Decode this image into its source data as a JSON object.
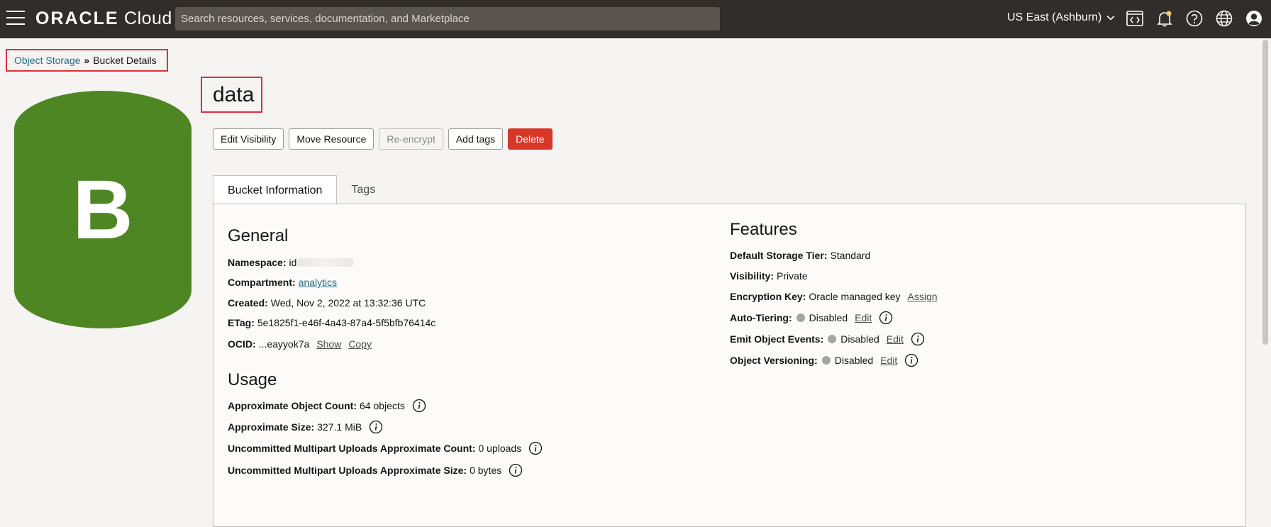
{
  "topbar": {
    "logo_brand": "ORACLE",
    "logo_product": "Cloud",
    "search_placeholder": "Search resources, services, documentation, and Marketplace",
    "region": "US East (Ashburn)",
    "icons": [
      "menu-icon",
      "code-editor-icon",
      "notification-bell-icon",
      "help-icon",
      "language-globe-icon",
      "user-profile-icon"
    ],
    "notification_color": "#f0cc71"
  },
  "breadcrumb": {
    "parent": "Object Storage",
    "separator": "»",
    "current": "Bucket Details"
  },
  "avatar": {
    "letter": "B",
    "color": "#4d8623"
  },
  "bucket": {
    "name": "data"
  },
  "actions": {
    "edit_visibility": "Edit Visibility",
    "move_resource": "Move Resource",
    "re_encrypt": "Re-encrypt",
    "add_tags": "Add tags",
    "delete": "Delete"
  },
  "tabs": [
    {
      "label": "Bucket Information",
      "active": true
    },
    {
      "label": "Tags",
      "active": false
    }
  ],
  "general": {
    "title": "General",
    "namespace_label": "Namespace:",
    "namespace_value": "id",
    "compartment_label": "Compartment:",
    "compartment_value": "analytics",
    "created_label": "Created:",
    "created_value": "Wed, Nov 2, 2022 at 13:32:36 UTC",
    "etag_label": "ETag:",
    "etag_value": "5e1825f1-e46f-4a43-87a4-5f5bfb76414c",
    "ocid_label": "OCID:",
    "ocid_value": "...eayyok7a",
    "show_label": "Show",
    "copy_label": "Copy"
  },
  "usage": {
    "title": "Usage",
    "object_count_label": "Approximate Object Count:",
    "object_count_value": "64 objects",
    "size_label": "Approximate Size:",
    "size_value": "327.1 MiB",
    "multipart_count_label": "Uncommitted Multipart Uploads Approximate Count:",
    "multipart_count_value": "0 uploads",
    "multipart_size_label": "Uncommitted Multipart Uploads Approximate Size:",
    "multipart_size_value": "0 bytes"
  },
  "features": {
    "title": "Features",
    "storage_tier_label": "Default Storage Tier:",
    "storage_tier_value": "Standard",
    "visibility_label": "Visibility:",
    "visibility_value": "Private",
    "encryption_label": "Encryption Key:",
    "encryption_value": "Oracle managed key",
    "assign_label": "Assign",
    "auto_tiering_label": "Auto-Tiering:",
    "auto_tiering_value": "Disabled",
    "emit_events_label": "Emit Object Events:",
    "emit_events_value": "Disabled",
    "versioning_label": "Object Versioning:",
    "versioning_value": "Disabled",
    "edit_label": "Edit"
  }
}
